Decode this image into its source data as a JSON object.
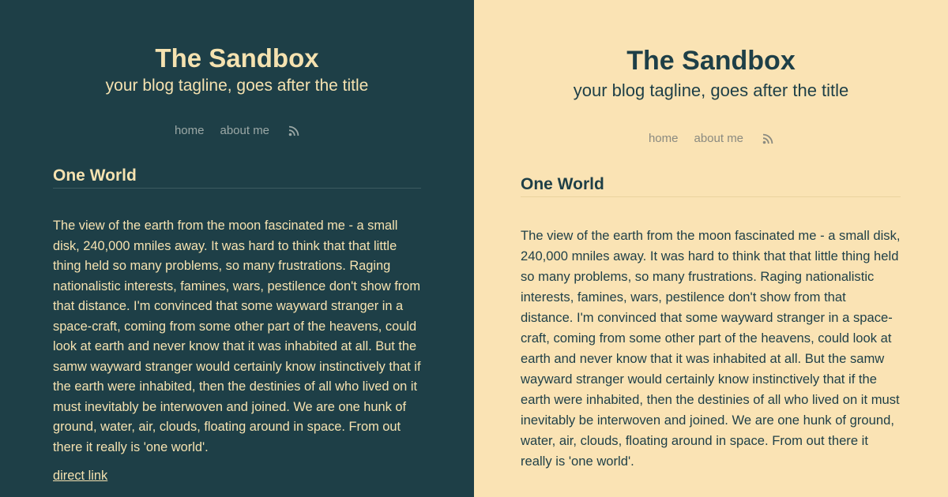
{
  "site": {
    "title": "The Sandbox",
    "tagline": "your blog tagline, goes after the title"
  },
  "nav": {
    "items": [
      {
        "label": "home"
      },
      {
        "label": "about me"
      }
    ],
    "rss_icon": "rss-icon"
  },
  "post": {
    "title": "One World",
    "body": "The view of the earth from the moon fascinated me - a small disk, 240,000 mniles away. It was hard to think that that little thing held so many problems, so many frustrations. Raging nationalistic interests, famines, wars, pestilence don't show from that distance. I'm convinced that some wayward stranger in a space-craft, coming from some other part of the heavens, could look at earth and never know that it was inhabited at all. But the samw wayward stranger would certainly know instinctively that if the earth were inhabited, then the destinies of all who lived on it must inevitably be interwoven and joined. We are one hunk of ground, water, air, clouds, floating around in space. From out there it really is 'one world'.",
    "link_label": "direct link"
  },
  "theme": {
    "dark_background": "#1e3f47",
    "dark_text": "#f5e2b0",
    "light_background": "#fae3b4",
    "light_text": "#1e3f47"
  }
}
